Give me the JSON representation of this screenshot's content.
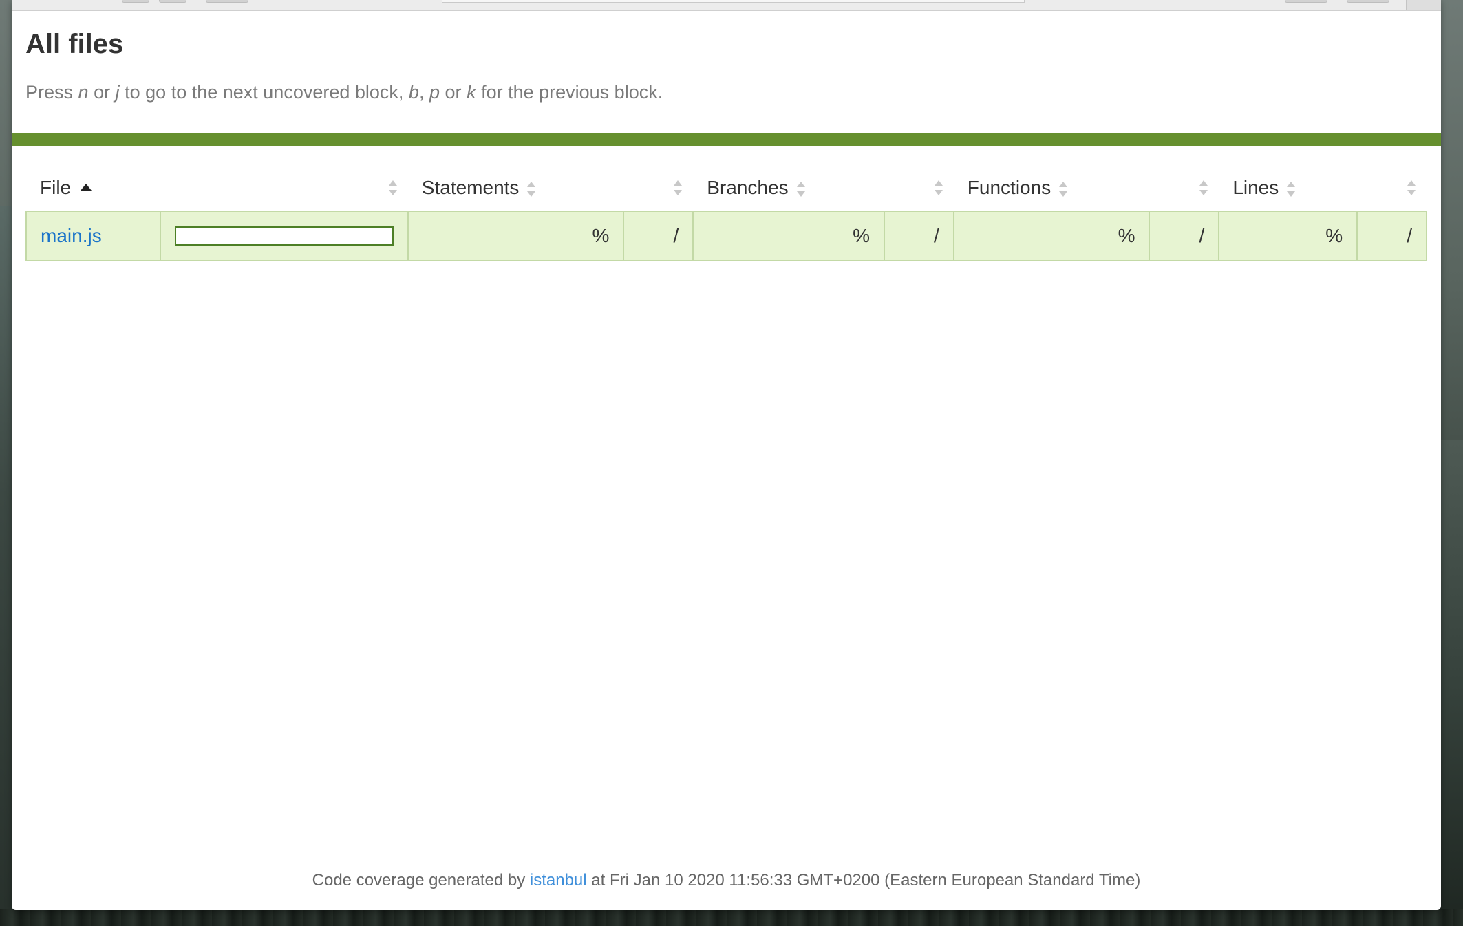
{
  "page": {
    "title": "All files",
    "help": {
      "press": "Press",
      "key_n": "n",
      "or1": "or",
      "key_j": "j",
      "next_text": "to go to the next uncovered block,",
      "key_b": "b",
      "comma": ",",
      "key_p": "p",
      "or2": "or",
      "key_k": "k",
      "prev_text": "for the previous block."
    }
  },
  "table": {
    "headers": {
      "file": "File",
      "statements": "Statements",
      "branches": "Branches",
      "functions": "Functions",
      "lines": "Lines"
    },
    "sort": {
      "column": "File",
      "direction": "ascending"
    },
    "rows": [
      {
        "file": "main.js",
        "statements_pct": "%",
        "statements_abs": "/",
        "branches_pct": "%",
        "branches_abs": "/",
        "functions_pct": "%",
        "functions_abs": "/",
        "lines_pct": "%",
        "lines_abs": "/"
      }
    ]
  },
  "footer": {
    "prefix": "Code coverage generated by",
    "link": "istanbul",
    "suffix": "at Fri Jan 10 2020 11:56:33 GMT+0200 (Eastern European Standard Time)"
  },
  "colors": {
    "status_bar": "#66902f",
    "row_bg": "#e7f4d2",
    "row_border": "#c3d9a6",
    "link": "#1a73c9"
  }
}
